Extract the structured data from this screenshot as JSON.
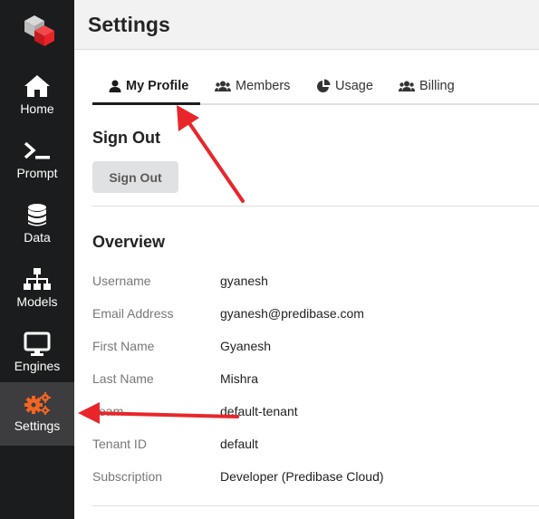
{
  "brand": {
    "logo_colors": {
      "front": "#e8242a",
      "back": "#cfcfcf"
    }
  },
  "sidebar": {
    "items": [
      {
        "label": "Home",
        "icon": "home-icon"
      },
      {
        "label": "Prompt",
        "icon": "terminal-icon"
      },
      {
        "label": "Data",
        "icon": "database-icon"
      },
      {
        "label": "Models",
        "icon": "sitemap-icon"
      },
      {
        "label": "Engines",
        "icon": "desktop-icon"
      },
      {
        "label": "Settings",
        "icon": "cogs-icon",
        "active": true,
        "accent": "#f26522"
      }
    ]
  },
  "header": {
    "title": "Settings"
  },
  "tabs": [
    {
      "label": "My Profile",
      "icon": "user-icon",
      "active": true
    },
    {
      "label": "Members",
      "icon": "users-icon"
    },
    {
      "label": "Usage",
      "icon": "pie-chart-icon"
    },
    {
      "label": "Billing",
      "icon": "users-icon"
    }
  ],
  "signout_section": {
    "title": "Sign Out",
    "button_label": "Sign Out"
  },
  "overview": {
    "title": "Overview",
    "rows": [
      {
        "label": "Username",
        "value": "gyanesh"
      },
      {
        "label": "Email Address",
        "value": "gyanesh@predibase.com"
      },
      {
        "label": "First Name",
        "value": "Gyanesh"
      },
      {
        "label": "Last Name",
        "value": "Mishra"
      },
      {
        "label": "Team",
        "value": "default-tenant"
      },
      {
        "label": "Tenant ID",
        "value": "default"
      },
      {
        "label": "Subscription",
        "value": "Developer (Predibase Cloud)"
      }
    ]
  },
  "annotation_color": "#e8262a"
}
